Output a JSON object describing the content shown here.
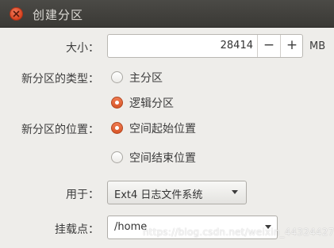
{
  "window": {
    "title": "创建分区"
  },
  "size": {
    "label": "大小：",
    "value": "28414",
    "decrement": "−",
    "increment": "+",
    "unit": "MB"
  },
  "partition_type": {
    "label": "新分区的类型：",
    "options": [
      {
        "label": "主分区",
        "selected": false
      },
      {
        "label": "逻辑分区",
        "selected": true
      }
    ]
  },
  "partition_location": {
    "label": "新分区的位置：",
    "options": [
      {
        "label": "空间起始位置",
        "selected": true
      },
      {
        "label": "空间结束位置",
        "selected": false
      }
    ]
  },
  "use_as": {
    "label": "用于：",
    "value": "Ext4 日志文件系统"
  },
  "mount_point": {
    "label": "挂载点：",
    "value": "/home"
  },
  "watermark": "https://blog.csdn.net/weixin_44324427",
  "colors": {
    "accent": "#dd5a2a",
    "titlebar": "#3f3e3a",
    "background": "#eeedea"
  }
}
